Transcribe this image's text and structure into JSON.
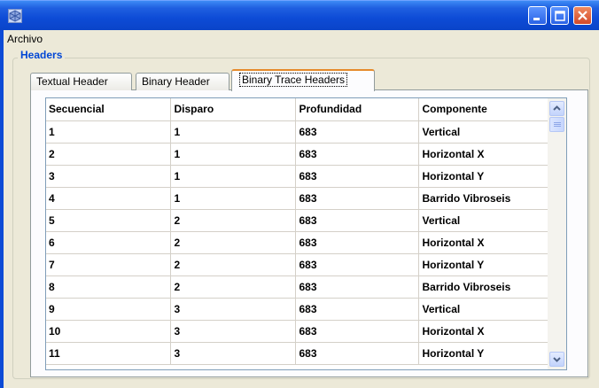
{
  "window": {
    "title": "",
    "colors": {
      "titlebar": "#0d4bd6",
      "close": "#d3492a",
      "accent_tab": "#e68b2c",
      "group_title": "#0046d5"
    }
  },
  "menu": {
    "items": [
      "Archivo"
    ]
  },
  "group": {
    "title": "Headers"
  },
  "tabs": [
    {
      "label": "Textual Header",
      "active": false
    },
    {
      "label": "Binary Header",
      "active": false
    },
    {
      "label": "Binary Trace Headers",
      "active": true
    }
  ],
  "table": {
    "columns": [
      "Secuencial",
      "Disparo",
      "Profundidad",
      "Componente"
    ],
    "rows": [
      [
        "1",
        "1",
        "683",
        "Vertical"
      ],
      [
        "2",
        "1",
        "683",
        "Horizontal X"
      ],
      [
        "3",
        "1",
        "683",
        "Horizontal Y"
      ],
      [
        "4",
        "1",
        "683",
        "Barrido Vibroseis"
      ],
      [
        "5",
        "2",
        "683",
        "Vertical"
      ],
      [
        "6",
        "2",
        "683",
        "Horizontal X"
      ],
      [
        "7",
        "2",
        "683",
        "Horizontal Y"
      ],
      [
        "8",
        "2",
        "683",
        "Barrido Vibroseis"
      ],
      [
        "9",
        "3",
        "683",
        "Vertical"
      ],
      [
        "10",
        "3",
        "683",
        "Horizontal X"
      ],
      [
        "11",
        "3",
        "683",
        "Horizontal Y"
      ]
    ]
  },
  "icons": {
    "app": "app-icon",
    "minimize": "minimize-icon",
    "maximize": "maximize-icon",
    "close": "close-icon",
    "scroll_up": "chevron-up-icon",
    "scroll_down": "chevron-down-icon"
  }
}
